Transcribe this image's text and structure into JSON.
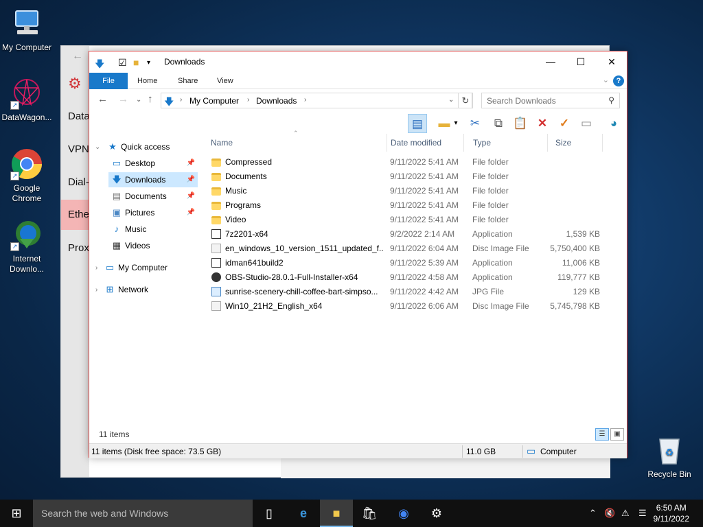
{
  "desktop": {
    "icons": [
      {
        "label": "My Computer",
        "icon": "computer-icon"
      },
      {
        "label": "DataWagon...",
        "icon": "datawagon-icon"
      },
      {
        "label": "Google\nChrome",
        "icon": "chrome-icon"
      },
      {
        "label": "Internet\nDownlo...",
        "icon": "idm-icon"
      },
      {
        "label": "Recycle Bin",
        "icon": "recycle-bin-icon"
      }
    ]
  },
  "background_window": {
    "nav": [
      "Data",
      "VPN",
      "Dial-",
      "Ethe",
      "Proxy"
    ]
  },
  "explorer": {
    "title": "Downloads",
    "ribbon_tabs": [
      "File",
      "Home",
      "Share",
      "View"
    ],
    "address": {
      "crumbs": [
        "My Computer",
        "Downloads"
      ]
    },
    "search": {
      "placeholder": "Search Downloads"
    },
    "nav_pane": {
      "quick_access": "Quick access",
      "quick_items": [
        {
          "label": "Desktop",
          "icon": "desktop-icon",
          "pinned": true
        },
        {
          "label": "Downloads",
          "icon": "download-arrow-icon",
          "pinned": true,
          "selected": true
        },
        {
          "label": "Documents",
          "icon": "documents-icon",
          "pinned": true
        },
        {
          "label": "Pictures",
          "icon": "pictures-icon",
          "pinned": true
        },
        {
          "label": "Music",
          "icon": "music-icon",
          "pinned": false
        },
        {
          "label": "Videos",
          "icon": "videos-icon",
          "pinned": false
        }
      ],
      "my_computer": "My Computer",
      "network": "Network"
    },
    "columns": [
      "Name",
      "Date modified",
      "Type",
      "Size"
    ],
    "files": [
      {
        "name": "Compressed",
        "date": "9/11/2022 5:41 AM",
        "type": "File folder",
        "size": "",
        "kind": "folder"
      },
      {
        "name": "Documents",
        "date": "9/11/2022 5:41 AM",
        "type": "File folder",
        "size": "",
        "kind": "folder"
      },
      {
        "name": "Music",
        "date": "9/11/2022 5:41 AM",
        "type": "File folder",
        "size": "",
        "kind": "folder"
      },
      {
        "name": "Programs",
        "date": "9/11/2022 5:41 AM",
        "type": "File folder",
        "size": "",
        "kind": "folder"
      },
      {
        "name": "Video",
        "date": "9/11/2022 5:41 AM",
        "type": "File folder",
        "size": "",
        "kind": "folder"
      },
      {
        "name": "7z2201-x64",
        "date": "9/2/2022 2:14 AM",
        "type": "Application",
        "size": "1,539 KB",
        "kind": "app"
      },
      {
        "name": "en_windows_10_version_1511_updated_f...",
        "date": "9/11/2022 6:04 AM",
        "type": "Disc Image File",
        "size": "5,750,400 KB",
        "kind": "disc"
      },
      {
        "name": "idman641build2",
        "date": "9/11/2022 5:39 AM",
        "type": "Application",
        "size": "11,006 KB",
        "kind": "app"
      },
      {
        "name": "OBS-Studio-28.0.1-Full-Installer-x64",
        "date": "9/11/2022 4:58 AM",
        "type": "Application",
        "size": "119,777 KB",
        "kind": "obs"
      },
      {
        "name": "sunrise-scenery-chill-coffee-bart-simpso...",
        "date": "9/11/2022 4:42 AM",
        "type": "JPG File",
        "size": "129 KB",
        "kind": "jpg"
      },
      {
        "name": "Win10_21H2_English_x64",
        "date": "9/11/2022 6:06 AM",
        "type": "Disc Image File",
        "size": "5,745,798 KB",
        "kind": "disc"
      }
    ],
    "item_count": "11 items",
    "status": {
      "left": "11 items (Disk free space: 73.5 GB)",
      "middle": "11.0 GB",
      "right": "Computer"
    }
  },
  "taskbar": {
    "search_placeholder": "Search the web and Windows",
    "time": "6:50 AM",
    "date": "9/11/2022"
  },
  "colors": {
    "accent": "#1979ca",
    "selection": "#cce8ff",
    "window_border": "#e04848"
  }
}
